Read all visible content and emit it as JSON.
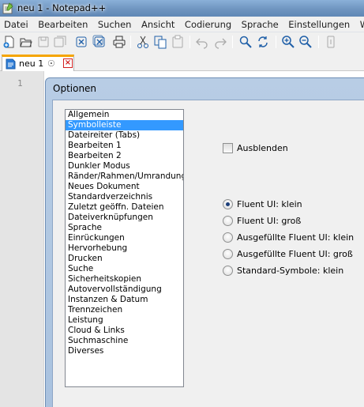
{
  "window": {
    "title": "neu 1 - Notepad++"
  },
  "menu": [
    "Datei",
    "Bearbeiten",
    "Suchen",
    "Ansicht",
    "Codierung",
    "Sprache",
    "Einstellungen",
    "Werkzeuge"
  ],
  "toolbar": {
    "icons": [
      "new-file-icon",
      "open-folder-icon",
      "save-icon",
      "save-all-icon",
      "close-icon",
      "close-all-icon",
      "print-icon",
      "cut-icon",
      "copy-icon",
      "paste-icon",
      "undo-icon",
      "redo-icon",
      "find-icon",
      "replace-icon",
      "zoom-in-icon",
      "zoom-out-icon",
      "sync-scroll-icon"
    ]
  },
  "tab": {
    "label": "neu 1",
    "pin_glyph": "☉",
    "close_glyph": "×"
  },
  "editor": {
    "line_number": "1"
  },
  "dialog": {
    "title": "Optionen",
    "categories": [
      "Allgemein",
      "Symbolleiste",
      "Dateireiter (Tabs)",
      "Bearbeiten 1",
      "Bearbeiten 2",
      "Dunkler Modus",
      "Ränder/Rahmen/Umrandung",
      "Neues Dokument",
      "Standardverzeichnis",
      "Zuletzt geöffn. Dateien",
      "Dateiverknüpfungen",
      "Sprache",
      "Einrückungen",
      "Hervorhebung",
      "Drucken",
      "Suche",
      "Sicherheitskopien",
      "Autovervollständigung",
      "Instanzen & Datum",
      "Trennzeichen",
      "Leistung",
      "Cloud & Links",
      "Suchmaschine",
      "Diverses"
    ],
    "selected_category": "Symbolleiste",
    "hide_checkbox": {
      "label": "Ausblenden",
      "checked": false
    },
    "icon_set": {
      "options": [
        "Fluent UI: klein",
        "Fluent UI: groß",
        "Ausgefüllte Fluent UI: klein",
        "Ausgefüllte Fluent UI: groß",
        "Standard-Symbole: klein"
      ],
      "selected": "Fluent UI: klein"
    }
  }
}
